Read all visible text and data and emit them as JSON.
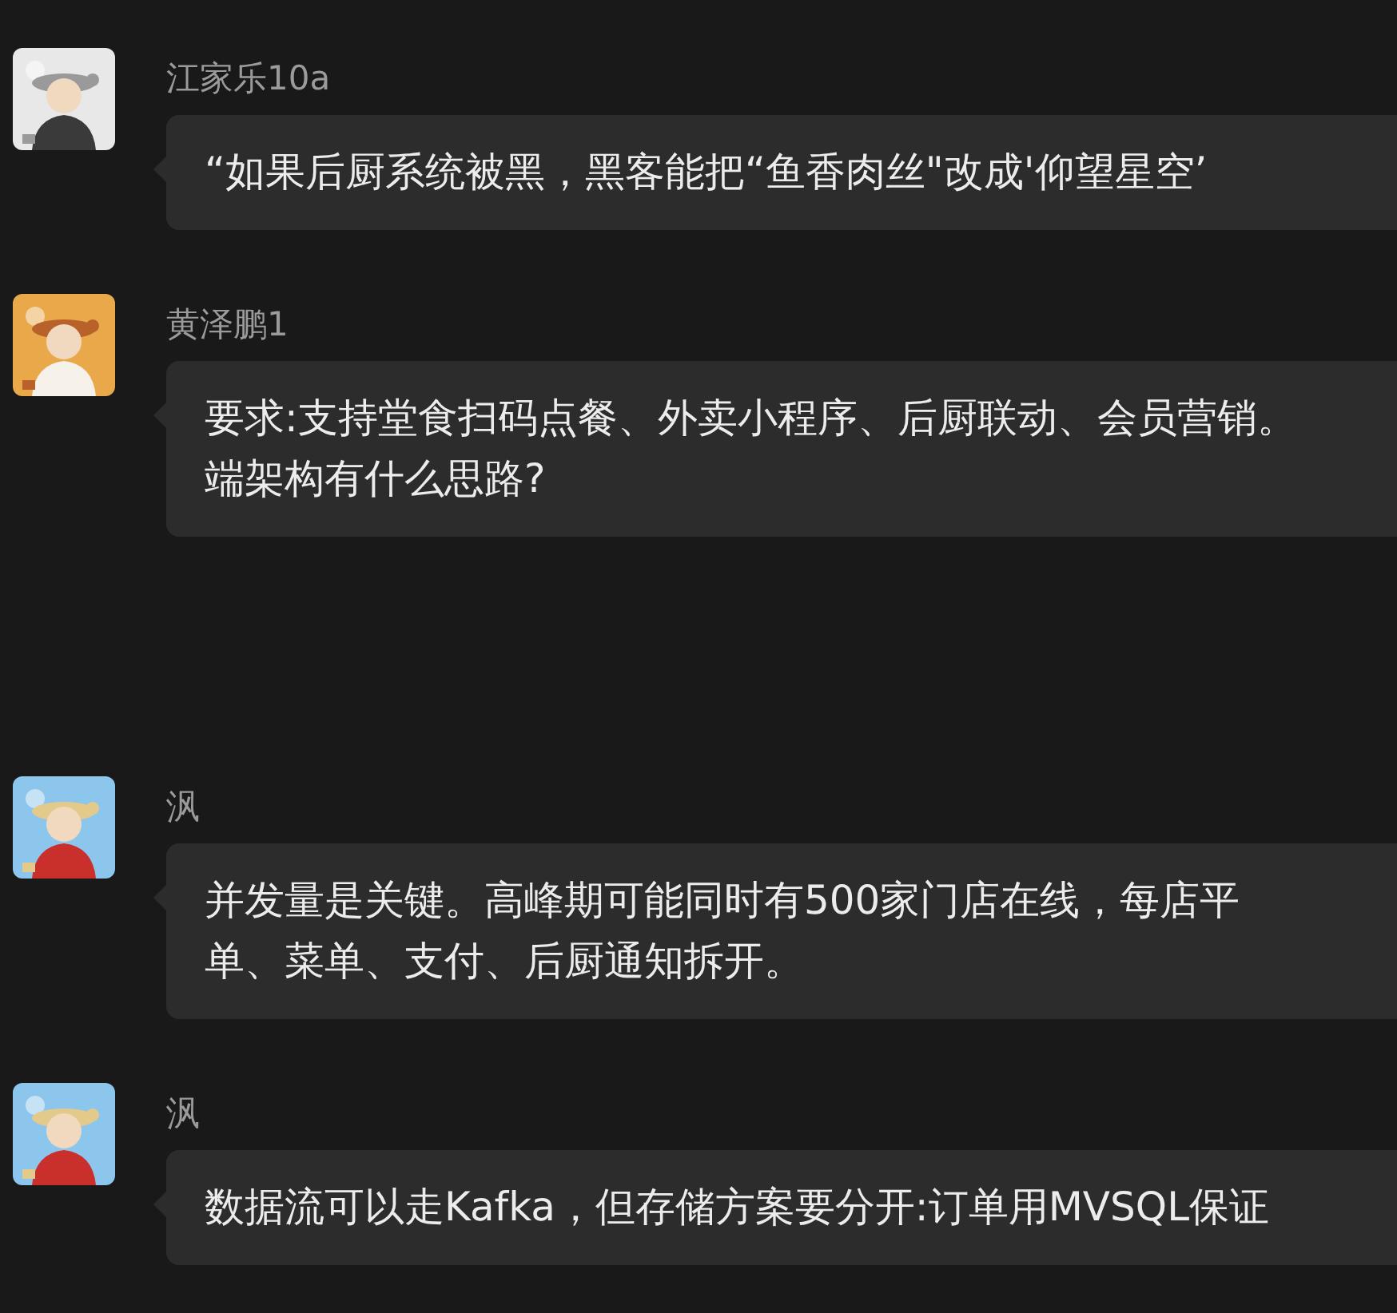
{
  "messages": [
    {
      "sender": "江家乐10a",
      "lines": [
        "“如果后厨系统被黑，黑客能把“鱼香肉丝\"改成'仰望星空’"
      ]
    },
    {
      "sender": "黄泽鹏1",
      "lines": [
        "要求:支持堂食扫码点餐、外卖小程序、后厨联动、会员营销。",
        "端架构有什么思路?"
      ]
    },
    {
      "sender": "沨",
      "lines": [
        "并发量是关键。高峰期可能同时有500家门店在线，每店平",
        "单、菜单、支付、后厨通知拆开。"
      ]
    },
    {
      "sender": "沨",
      "lines": [
        "数据流可以走Kafka，但存储方案要分开:订单用MVSQL保证"
      ]
    }
  ]
}
